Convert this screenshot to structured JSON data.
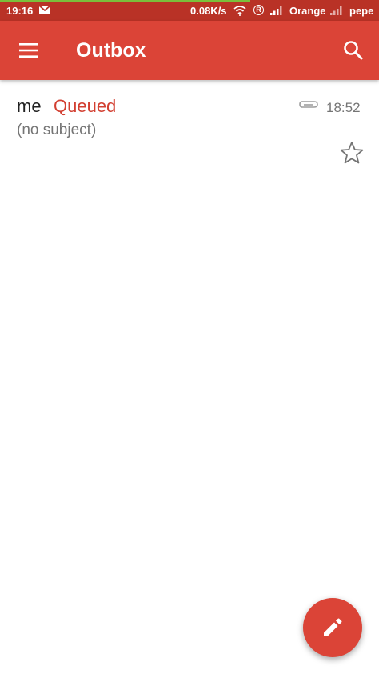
{
  "status_bar": {
    "time": "19:16",
    "speed": "0.08K/s",
    "roaming_badge": "R",
    "carrier": "Orange",
    "user": "pepe",
    "icons": [
      "gmail-notification-icon",
      "wifi-icon",
      "roaming-icon",
      "signal-icon",
      "signal-icon"
    ],
    "progress_fraction": 0.66
  },
  "toolbar": {
    "title": "Outbox",
    "menu_icon": "hamburger-menu-icon",
    "search_icon": "search-icon"
  },
  "messages": [
    {
      "sender": "me",
      "status": "Queued",
      "subject": "(no subject)",
      "time": "18:52",
      "has_attachment": true,
      "starred": false
    }
  ],
  "fab": {
    "icon": "pencil-icon"
  },
  "colors": {
    "app_bar": "#db4437",
    "status_bar": "#b93226",
    "queued": "#d23f31",
    "progress": "#7bbf3b"
  }
}
